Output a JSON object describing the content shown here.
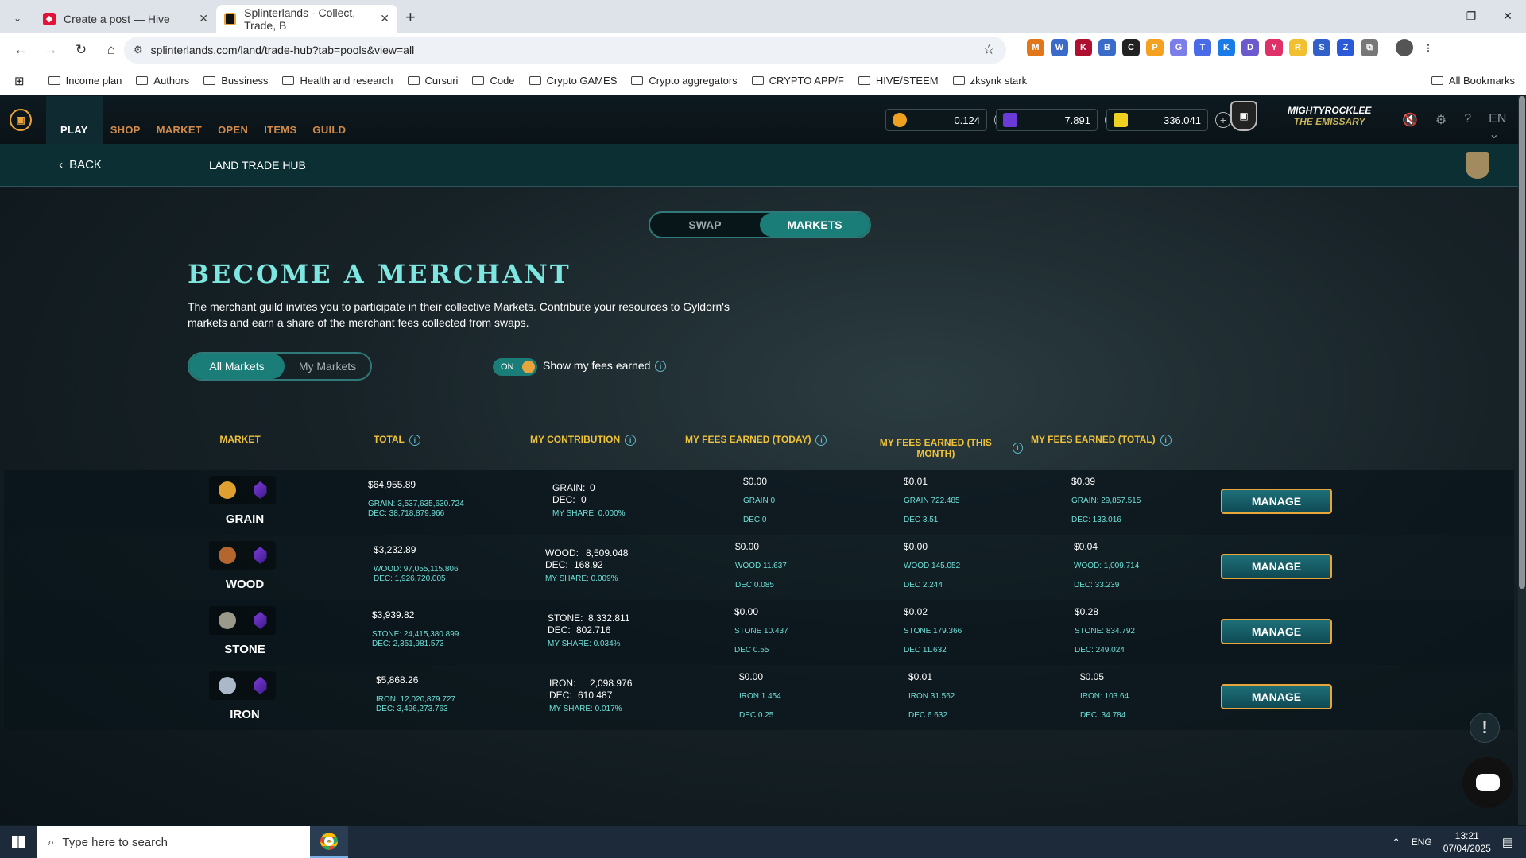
{
  "browser": {
    "tabs": [
      {
        "title": "Create a post — Hive"
      },
      {
        "title": "Splinterlands - Collect, Trade, B"
      }
    ],
    "url": "splinterlands.com/land/trade-hub?tab=pools&view=all",
    "bookmarks": [
      "Income plan",
      "Authors",
      "Bussiness",
      "Health and research",
      "Cursuri",
      "Code",
      "Crypto GAMES",
      "Crypto aggregators",
      "CRYPTO APP/F",
      "HIVE/STEEM",
      "zksynk stark"
    ],
    "all_bookmarks": "All Bookmarks"
  },
  "nav": {
    "items": [
      "PLAY",
      "SHOP",
      "MARKET",
      "OPEN",
      "ITEMS",
      "GUILD"
    ],
    "balances": {
      "credits": "0.124",
      "dec": "7.891",
      "sps": "336.041"
    },
    "player_name": "MIGHTYROCKLEE",
    "player_title": "THE EMISSARY",
    "lang": "EN"
  },
  "subbar": {
    "back": "BACK",
    "title": "LAND TRADE HUB"
  },
  "toggle_tabs": {
    "swap": "SWAP",
    "markets": "MARKETS"
  },
  "heading": "BECOME A MERCHANT",
  "intro": "The merchant guild invites you to participate in their collective Markets. Contribute your resources to Gyldorn's markets and earn a share of the merchant fees collected from swaps.",
  "filter": {
    "all": "All Markets",
    "mine": "My Markets",
    "toggle": "ON",
    "toggle_label": "Show my fees earned"
  },
  "columns": {
    "market": "MARKET",
    "total": "TOTAL",
    "contribution": "MY CONTRIBUTION",
    "today": "MY FEES EARNED (TODAY)",
    "month": "MY FEES EARNED (THIS MONTH)",
    "total_fees": "MY FEES EARNED (TOTAL)"
  },
  "markets": [
    {
      "name": "GRAIN",
      "total": "$64,955.89",
      "total_res": "GRAIN: 3,537,635,630.724",
      "total_dec": "DEC: 38,718,879.966",
      "contrib_res": "GRAIN:",
      "contrib_res_val": "0",
      "contrib_dec": "DEC:",
      "contrib_dec_val": "0",
      "share": "MY SHARE: 0.000%",
      "today": "$0.00",
      "today_res": "GRAIN 0",
      "today_dec": "DEC 0",
      "month": "$0.01",
      "month_res": "GRAIN 722.485",
      "month_dec": "DEC 3.51",
      "tot": "$0.39",
      "tot_res": "GRAIN: 29,857.515",
      "tot_dec": "DEC: 133.016",
      "manage": "MANAGE",
      "color": "#e0a030"
    },
    {
      "name": "WOOD",
      "total": "$3,232.89",
      "total_res": "WOOD: 97,055,115.806",
      "total_dec": "DEC: 1,926,720.005",
      "contrib_res": "WOOD:",
      "contrib_res_val": "8,509.048",
      "contrib_dec": "DEC:",
      "contrib_dec_val": "168.92",
      "share": "MY SHARE: 0.009%",
      "today": "$0.00",
      "today_res": "WOOD 11.637",
      "today_dec": "DEC 0.085",
      "month": "$0.00",
      "month_res": "WOOD 145.052",
      "month_dec": "DEC 2.244",
      "tot": "$0.04",
      "tot_res": "WOOD: 1,009.714",
      "tot_dec": "DEC: 33.239",
      "manage": "MANAGE",
      "color": "#b5652e"
    },
    {
      "name": "STONE",
      "total": "$3,939.82",
      "total_res": "STONE: 24,415,380.899",
      "total_dec": "DEC: 2,351,981.573",
      "contrib_res": "STONE:",
      "contrib_res_val": "8,332.811",
      "contrib_dec": "DEC:",
      "contrib_dec_val": "802.716",
      "share": "MY SHARE: 0.034%",
      "today": "$0.00",
      "today_res": "STONE 10.437",
      "today_dec": "DEC 0.55",
      "month": "$0.02",
      "month_res": "STONE 179.366",
      "month_dec": "DEC 11.632",
      "tot": "$0.28",
      "tot_res": "STONE: 834.792",
      "tot_dec": "DEC: 249.024",
      "manage": "MANAGE",
      "color": "#9a9a8a"
    },
    {
      "name": "IRON",
      "total": "$5,868.26",
      "total_res": "IRON: 12,020,879.727",
      "total_dec": "DEC: 3,496,273.763",
      "contrib_res": "IRON:",
      "contrib_res_val": "2,098.976",
      "contrib_dec": "DEC:",
      "contrib_dec_val": "610.487",
      "share": "MY SHARE: 0.017%",
      "today": "$0.00",
      "today_res": "IRON 1.454",
      "today_dec": "DEC 0.25",
      "month": "$0.01",
      "month_res": "IRON 31.562",
      "month_dec": "DEC 6.632",
      "tot": "$0.05",
      "tot_res": "IRON: 103.64",
      "tot_dec": "DEC: 34.784",
      "manage": "MANAGE",
      "color": "#aab8c8"
    }
  ],
  "taskbar": {
    "search": "Type here to search",
    "lang": "ENG",
    "time": "13:21",
    "date": "07/04/2025"
  }
}
